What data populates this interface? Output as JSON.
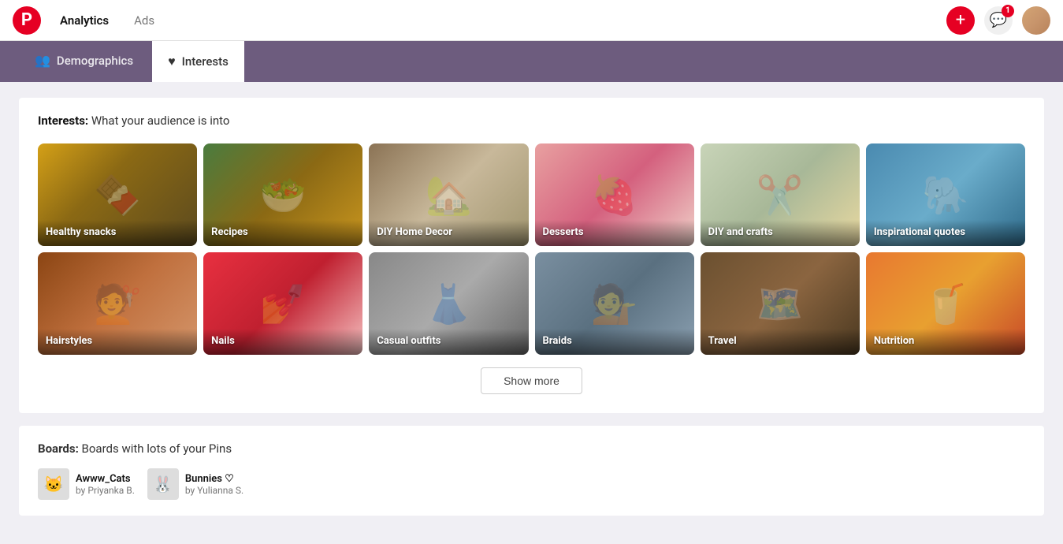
{
  "header": {
    "logo_char": "P",
    "nav": [
      {
        "id": "analytics",
        "label": "Analytics",
        "active": true
      },
      {
        "id": "ads",
        "label": "Ads",
        "active": false
      }
    ],
    "add_icon": "+",
    "notification_count": "1"
  },
  "tabs": [
    {
      "id": "demographics",
      "label": "Demographics",
      "icon": "👥",
      "active": false
    },
    {
      "id": "interests",
      "label": "Interests",
      "icon": "♥",
      "active": true
    }
  ],
  "interests_section": {
    "title_strong": "Interests:",
    "title_rest": " What your audience is into",
    "items": [
      {
        "id": "healthy-snacks",
        "label": "Healthy snacks",
        "emoji": "🍫",
        "bg_class": "bg-snacks"
      },
      {
        "id": "recipes",
        "label": "Recipes",
        "emoji": "🥗",
        "bg_class": "bg-recipes"
      },
      {
        "id": "diy-home-decor",
        "label": "DIY Home Decor",
        "emoji": "🏡",
        "bg_class": "bg-diy-home"
      },
      {
        "id": "desserts",
        "label": "Desserts",
        "emoji": "🍓",
        "bg_class": "bg-desserts"
      },
      {
        "id": "diy-crafts",
        "label": "DIY and crafts",
        "emoji": "✂️",
        "bg_class": "bg-diy-crafts"
      },
      {
        "id": "inspirational-quotes",
        "label": "Inspirational quotes",
        "emoji": "🐘",
        "bg_class": "bg-inspirational"
      },
      {
        "id": "hairstyles",
        "label": "Hairstyles",
        "emoji": "💇",
        "bg_class": "bg-hairstyles"
      },
      {
        "id": "nails",
        "label": "Nails",
        "emoji": "💅",
        "bg_class": "bg-nails"
      },
      {
        "id": "casual-outfits",
        "label": "Casual outfits",
        "emoji": "👗",
        "bg_class": "bg-casual"
      },
      {
        "id": "braids",
        "label": "Braids",
        "emoji": "💁",
        "bg_class": "bg-braids"
      },
      {
        "id": "travel",
        "label": "Travel",
        "emoji": "🗺️",
        "bg_class": "bg-travel"
      },
      {
        "id": "nutrition",
        "label": "Nutrition",
        "emoji": "🥤",
        "bg_class": "bg-nutrition"
      }
    ],
    "show_more_label": "Show more"
  },
  "boards_section": {
    "title_strong": "Boards:",
    "title_rest": " Boards with lots of your Pins",
    "items": [
      {
        "id": "awww-cats",
        "label": "Awww_Cats",
        "by": "by Priyanka B.",
        "emoji": "🐱"
      },
      {
        "id": "bunnies",
        "label": "Bunnies ♡",
        "by": "by Yulianna S.",
        "emoji": "🐰"
      }
    ]
  }
}
